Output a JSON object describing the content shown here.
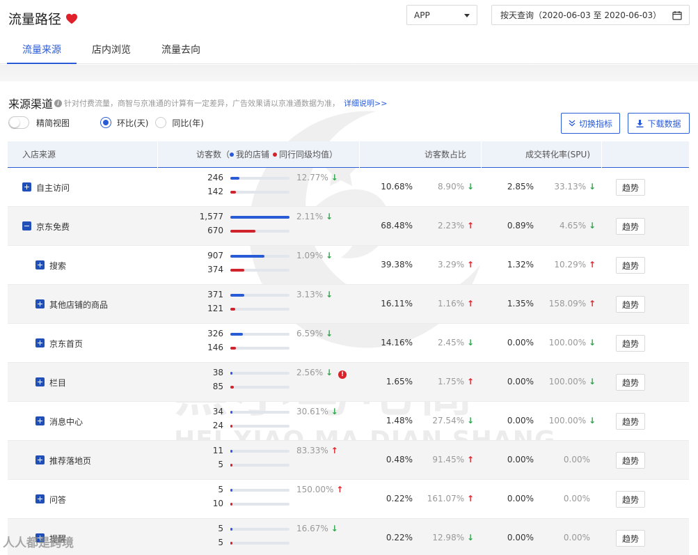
{
  "header": {
    "title": "流量路径",
    "platform": "APP",
    "date_range": "按天查询（2020-06-03 至 2020-06-03）",
    "tabs": [
      "流量来源",
      "店内浏览",
      "流量去向"
    ]
  },
  "section": {
    "title": "来源渠道",
    "note": "针对付费流量，商智与京准通的计算有一定差异，广告效果请以京准通数据为准，",
    "detail_link": "详细说明>>",
    "toggle_label": "精简视图",
    "radio_day": "环比(天)",
    "radio_year": "同比(年)",
    "btn_switch": "切换指标",
    "btn_download": "下载数据"
  },
  "table": {
    "col_source": "入店来源",
    "col_visitors": "访客数（",
    "legend_mine": "我的店铺",
    "legend_peer": "同行同级均值）",
    "col_share": "访客数占比",
    "col_cvr": "成交转化率(SPU)",
    "trend_label": "趋势",
    "colors": {
      "mine": "#2a5bd7",
      "peer": "#d1232b"
    },
    "bar_max": 1577,
    "rows": [
      {
        "label": "自主访问",
        "level": 0,
        "expanded": false,
        "mine": "246",
        "peer": "142",
        "mine_v": 246,
        "peer_v": 142,
        "visitor_change": "12.77%",
        "visitor_dir": "down",
        "warn": false,
        "share": "10.68%",
        "share_change": "8.90%",
        "share_dir": "down",
        "cvr": "2.85%",
        "cvr_change": "33.13%",
        "cvr_dir": "down"
      },
      {
        "label": "京东免费",
        "level": 0,
        "expanded": true,
        "mine": "1,577",
        "peer": "670",
        "mine_v": 1577,
        "peer_v": 670,
        "visitor_change": "2.11%",
        "visitor_dir": "down",
        "warn": false,
        "share": "68.48%",
        "share_change": "2.23%",
        "share_dir": "up",
        "cvr": "0.89%",
        "cvr_change": "4.65%",
        "cvr_dir": "down"
      },
      {
        "label": "搜索",
        "level": 1,
        "expanded": false,
        "mine": "907",
        "peer": "374",
        "mine_v": 907,
        "peer_v": 374,
        "visitor_change": "1.09%",
        "visitor_dir": "down",
        "warn": false,
        "share": "39.38%",
        "share_change": "3.29%",
        "share_dir": "up",
        "cvr": "1.32%",
        "cvr_change": "10.29%",
        "cvr_dir": "up"
      },
      {
        "label": "其他店铺的商品",
        "level": 1,
        "expanded": false,
        "mine": "371",
        "peer": "121",
        "mine_v": 371,
        "peer_v": 121,
        "visitor_change": "3.13%",
        "visitor_dir": "down",
        "warn": false,
        "share": "16.11%",
        "share_change": "1.16%",
        "share_dir": "up",
        "cvr": "1.35%",
        "cvr_change": "158.09%",
        "cvr_dir": "up"
      },
      {
        "label": "京东首页",
        "level": 1,
        "expanded": false,
        "mine": "326",
        "peer": "146",
        "mine_v": 326,
        "peer_v": 146,
        "visitor_change": "6.59%",
        "visitor_dir": "down",
        "warn": false,
        "share": "14.16%",
        "share_change": "2.45%",
        "share_dir": "down",
        "cvr": "0.00%",
        "cvr_change": "100.00%",
        "cvr_dir": "down"
      },
      {
        "label": "栏目",
        "level": 1,
        "expanded": false,
        "mine": "38",
        "peer": "85",
        "mine_v": 38,
        "peer_v": 85,
        "visitor_change": "2.56%",
        "visitor_dir": "down",
        "warn": true,
        "share": "1.65%",
        "share_change": "1.75%",
        "share_dir": "up",
        "cvr": "0.00%",
        "cvr_change": "100.00%",
        "cvr_dir": "down"
      },
      {
        "label": "消息中心",
        "level": 1,
        "expanded": false,
        "mine": "34",
        "peer": "24",
        "mine_v": 34,
        "peer_v": 24,
        "visitor_change": "30.61%",
        "visitor_dir": "down",
        "warn": false,
        "share": "1.48%",
        "share_change": "27.54%",
        "share_dir": "down",
        "cvr": "0.00%",
        "cvr_change": "100.00%",
        "cvr_dir": "down"
      },
      {
        "label": "推荐落地页",
        "level": 1,
        "expanded": false,
        "mine": "11",
        "peer": "5",
        "mine_v": 11,
        "peer_v": 5,
        "visitor_change": "83.33%",
        "visitor_dir": "up",
        "warn": false,
        "share": "0.48%",
        "share_change": "91.45%",
        "share_dir": "up",
        "cvr": "0.00%",
        "cvr_change": "0.00%",
        "cvr_dir": "none"
      },
      {
        "label": "问答",
        "level": 1,
        "expanded": false,
        "mine": "5",
        "peer": "10",
        "mine_v": 5,
        "peer_v": 10,
        "visitor_change": "150.00%",
        "visitor_dir": "up",
        "warn": false,
        "share": "0.22%",
        "share_change": "161.07%",
        "share_dir": "up",
        "cvr": "0.00%",
        "cvr_change": "0.00%",
        "cvr_dir": "none"
      },
      {
        "label": "提醒",
        "level": 1,
        "expanded": false,
        "mine": "5",
        "peer": "5",
        "mine_v": 5,
        "peer_v": 5,
        "visitor_change": "16.67%",
        "visitor_dir": "down",
        "warn": false,
        "share": "0.22%",
        "share_change": "12.98%",
        "share_dir": "down",
        "cvr": "0.00%",
        "cvr_change": "0.00%",
        "cvr_dir": "none"
      }
    ]
  },
  "watermark": {
    "cn": "黑小马电商",
    "en": "HEI XIAO MA DIAN SHANG",
    "corner": "人人都是跨境"
  }
}
